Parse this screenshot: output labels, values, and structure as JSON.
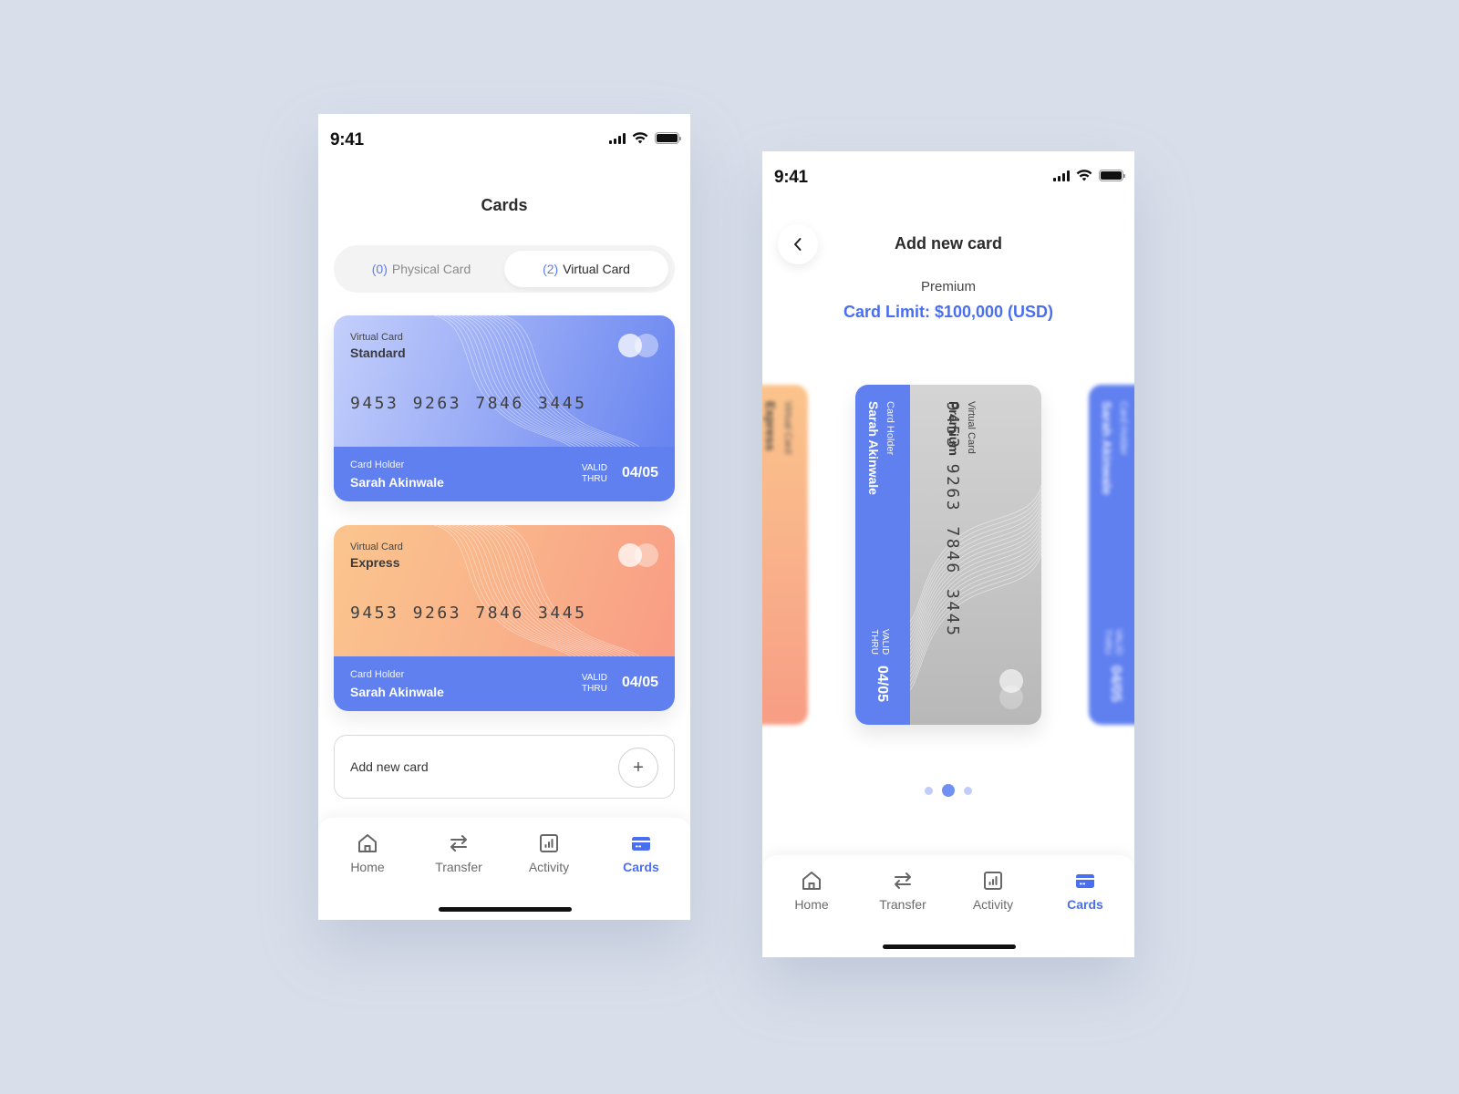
{
  "status_bar": {
    "time": "9:41"
  },
  "cards_screen": {
    "title": "Cards",
    "segments": [
      {
        "count": "(0)",
        "label": "Physical Card",
        "selected": false
      },
      {
        "count": "(2)",
        "label": "Virtual Card",
        "selected": true
      }
    ],
    "cards": [
      {
        "type_label": "Virtual Card",
        "type_name": "Standard",
        "number": "9453 9263 7846 3445",
        "holder_label": "Card Holder",
        "holder_name": "Sarah Akinwale",
        "valid_label_1": "VALID",
        "valid_label_2": "THRU",
        "expiry": "04/05",
        "color": "#8fa3f5"
      },
      {
        "type_label": "Virtual Card",
        "type_name": "Express",
        "number": "9453 9263 7846 3445",
        "holder_label": "Card Holder",
        "holder_name": "Sarah Akinwale",
        "valid_label_1": "VALID",
        "valid_label_2": "THRU",
        "expiry": "04/05",
        "color": "#f9b38a"
      }
    ],
    "add_card": {
      "label": "Add new card",
      "icon": "plus-icon",
      "symbol": "+"
    }
  },
  "add_card_screen": {
    "title": "Add new card",
    "back_icon": "chevron-left-icon",
    "plan_name": "Premium",
    "card_limit": "Card Limit: $100,000 (USD)",
    "carousel": {
      "prev_card": {
        "type_label": "Virtual Card",
        "type_name": "Express"
      },
      "current_card": {
        "type_label": "Virtual Card",
        "type_name": "Premium",
        "number": "9453 9263 7846 3445",
        "holder_label": "Card Holder",
        "holder_name": "Sarah Akinwale",
        "valid_label_1": "VALID",
        "valid_label_2": "THRU",
        "expiry": "04/05"
      },
      "next_card": {
        "holder_label": "Card Holder",
        "holder_name": "Sarah Akinwale",
        "valid_label_1": "VALID",
        "valid_label_2": "THRU",
        "expiry": "04/05"
      },
      "page_count": 3,
      "active_page": 2
    }
  },
  "tab_bar": {
    "items": [
      {
        "label": "Home",
        "icon": "home-icon",
        "active": false
      },
      {
        "label": "Transfer",
        "icon": "transfer-arrows-icon",
        "active": false
      },
      {
        "label": "Activity",
        "icon": "bar-chart-icon",
        "active": false
      },
      {
        "label": "Cards",
        "icon": "credit-card-icon",
        "active": true
      }
    ]
  },
  "colors": {
    "accent": "#4a6ef0",
    "card_strip": "#6080f0",
    "background": "#d9dfea"
  }
}
